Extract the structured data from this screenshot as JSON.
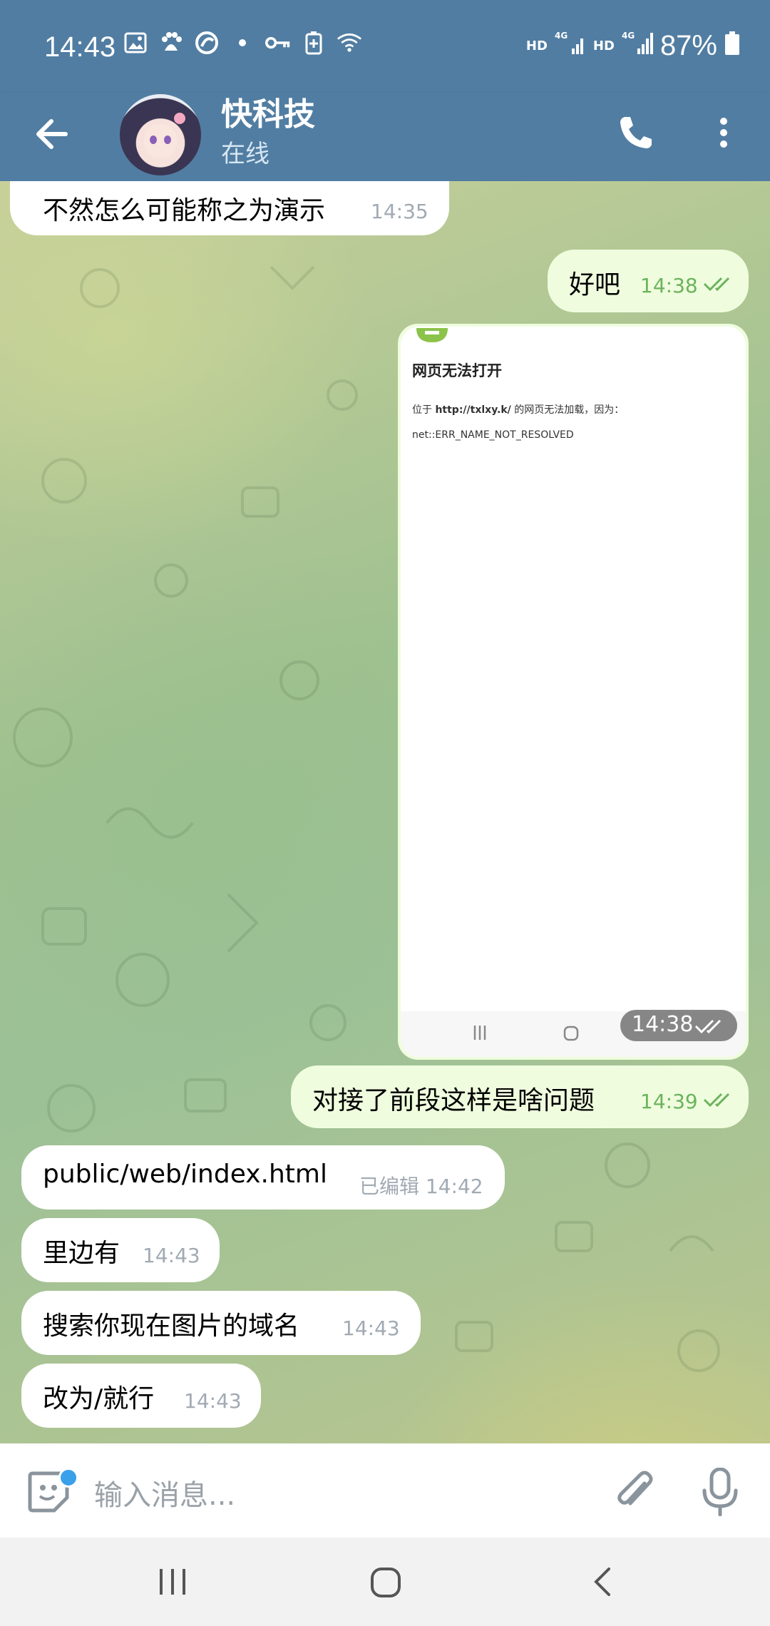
{
  "status_bar": {
    "time": "14:43",
    "battery": "87%",
    "network_label": "HD",
    "network_label_2": "HD",
    "icons": [
      "image-icon",
      "baidu-icon",
      "app-icon",
      "dot-icon",
      "vpn-key-icon",
      "battery-saver-icon",
      "wifi-icon",
      "signal-4g-icon",
      "signal-4g-icon-2",
      "battery-icon"
    ]
  },
  "header": {
    "title": "快科技",
    "status": "在线"
  },
  "messages": [
    {
      "id": "m1",
      "direction": "in",
      "text": "不然怎么可能称之为演示",
      "time": "14:35"
    },
    {
      "id": "m2",
      "direction": "out",
      "text": "好吧",
      "time": "14:38",
      "read": true
    },
    {
      "id": "m3",
      "direction": "out",
      "type": "image",
      "time": "14:38",
      "read": true,
      "image": {
        "heading": "网页无法打开",
        "line1_prefix": "位于 ",
        "line1_url": "http://txlxy.k/",
        "line1_suffix": " 的网页无法加载，因为：",
        "line2": "net::ERR_NAME_NOT_RESOLVED"
      }
    },
    {
      "id": "m4",
      "direction": "out",
      "text": "对接了前段这样是啥问题",
      "time": "14:39",
      "read": true
    },
    {
      "id": "m5",
      "direction": "in",
      "text": "public/web/index.html",
      "time": "已编辑 14:42"
    },
    {
      "id": "m6",
      "direction": "in",
      "text": "里边有",
      "time": "14:43"
    },
    {
      "id": "m7",
      "direction": "in",
      "text": "搜索你现在图片的域名",
      "time": "14:43"
    },
    {
      "id": "m8",
      "direction": "in",
      "text": "改为/就行",
      "time": "14:43"
    }
  ],
  "input": {
    "placeholder": "输入消息..."
  },
  "colors": {
    "header_bg": "#517da2",
    "incoming_bubble": "#ffffff",
    "outgoing_bubble": "#effdde",
    "outgoing_meta": "#6cb35c",
    "incoming_meta": "#a1aab3",
    "accent_dot": "#3aa0ea"
  }
}
